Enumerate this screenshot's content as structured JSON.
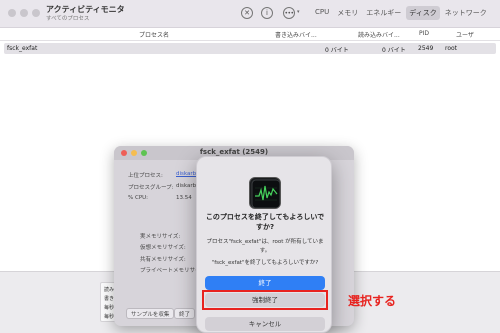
{
  "window": {
    "title": "アクティビティモニタ",
    "subtitle": "すべてのプロセス",
    "tabs": [
      {
        "label": "CPU",
        "active": false
      },
      {
        "label": "メモリ",
        "active": false
      },
      {
        "label": "エネルギー",
        "active": false
      },
      {
        "label": "ディスク",
        "active": true
      },
      {
        "label": "ネットワーク",
        "active": false
      }
    ],
    "icons": {
      "stop": "x-circle-icon",
      "info": "info-icon",
      "more": "ellipsis-icon"
    }
  },
  "table": {
    "headers": [
      "プロセス名",
      "書き込みバイ...",
      "読み込みバイ...",
      "PID",
      "ユーザ"
    ],
    "rows": [
      {
        "name": "fsck_exfat",
        "bytes_written": "0 バイト",
        "bytes_read": "0 バイト",
        "pid": "2549",
        "user": "root"
      }
    ]
  },
  "bottom_panel": {
    "labels": [
      "読み込",
      "書き込",
      "毎秒読",
      "毎秒書"
    ]
  },
  "info_window": {
    "title": "fsck_exfat (2549)",
    "parent_label": "上位プロセス:",
    "parent_value": "diskarb",
    "group_label": "プロセスグループ:",
    "group_value": "diskarb",
    "cpu_label": "% CPU:",
    "cpu_value": "13.54",
    "real_mem_label": "実メモリサイズ:",
    "virtual_mem_label": "仮想メモリサイズ:",
    "shared_mem_label": "共有メモリサイズ:",
    "private_mem_label": "プライベートメモリサイズ:",
    "sample_button": "サンプルを収集",
    "quit_button": "終了"
  },
  "alert": {
    "title": "このプロセスを終了してもよろしいですか?",
    "message": "プロセス\"fsck_exfat\"は、root が所有しています。",
    "question": "\"fsck_exfat\"を終了してもよろしいですか?",
    "quit_button": "終了",
    "force_quit_button": "強制終了",
    "cancel_button": "キャンセル"
  },
  "annotation": {
    "text": "選択する",
    "color": "#e8231f"
  },
  "colors": {
    "accent": "#2f7ff5",
    "highlight": "#e8231f"
  }
}
